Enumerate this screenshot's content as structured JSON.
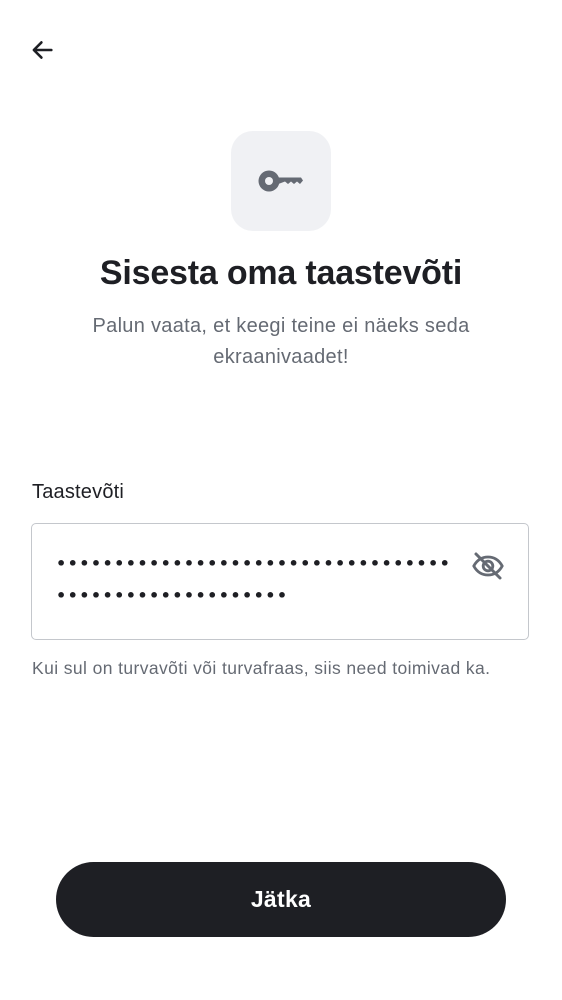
{
  "header": {
    "back_icon": "arrow-left-icon"
  },
  "hero": {
    "icon": "key-icon",
    "title": "Sisesta oma taastevõti",
    "subtitle": "Palun vaata, et keegi teine ei näeks seda ekraanivaadet!"
  },
  "recovery_field": {
    "label": "Taastevõti",
    "value": "••••••••••••••••••••••••••••••••••••••••••••••••••••••",
    "visibility_icon": "eye-off-icon",
    "hint": "Kui sul on turvavõti või turvafraas, siis need toimivad ka."
  },
  "actions": {
    "continue_label": "Jätka"
  },
  "colors": {
    "primary": "#1e1f24",
    "tile_bg": "#f0f1f4",
    "muted_text": "#656a73",
    "border": "#c4c7cc"
  }
}
